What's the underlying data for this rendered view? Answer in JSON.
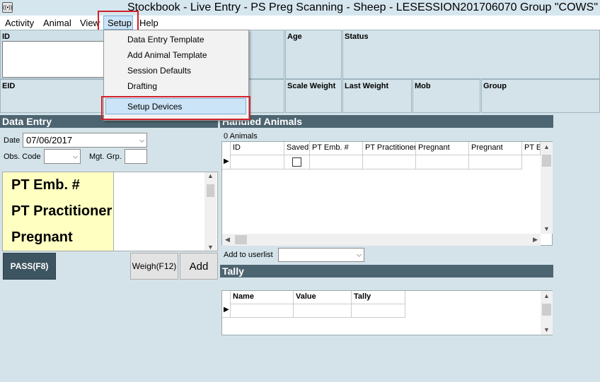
{
  "window": {
    "title": "Stockbook - Live Entry - PS Preg Scanning - Sheep - LESESSION201706070 Group \"COWS\"",
    "icon": "antenna-icon"
  },
  "menubar": [
    "Activity",
    "Animal",
    "View",
    "Setup",
    "Help"
  ],
  "setup_menu": [
    "Data Entry Template",
    "Add Animal Template",
    "Session Defaults",
    "Drafting",
    "Setup Devices"
  ],
  "header_fields": {
    "id": "ID",
    "age": "Age",
    "status": "Status",
    "eid": "EID",
    "scale_weight": "Scale Weight",
    "last_weight": "Last Weight",
    "mob": "Mob",
    "group": "Group"
  },
  "data_entry": {
    "title": "Data Entry",
    "date_label": "Date",
    "date_value": "07/06/2017",
    "obs_code_label": "Obs. Code",
    "mgt_grp_label": "Mgt. Grp.",
    "rows": [
      "PT Emb. #",
      "PT Practitioner",
      "Pregnant"
    ],
    "pass_button": "PASS(F8)",
    "weigh_button": "Weigh(F12)",
    "add_button": "Add"
  },
  "handled_animals": {
    "title": "Handled Animals",
    "count": "0 Animals",
    "columns": [
      "ID",
      "Saved",
      "PT Emb. #",
      "PT Practitioner",
      "Pregnant",
      "Pregnant",
      "PT Er"
    ],
    "add_to_userlist_label": "Add to userlist"
  },
  "tally": {
    "title": "Tally",
    "columns": [
      "Name",
      "Value",
      "Tally"
    ]
  },
  "colors": {
    "panel_header": "#4d6570",
    "highlight_box": "#d1212a",
    "label_yellow": "#ffffc2",
    "background": "#d4e3ea"
  }
}
